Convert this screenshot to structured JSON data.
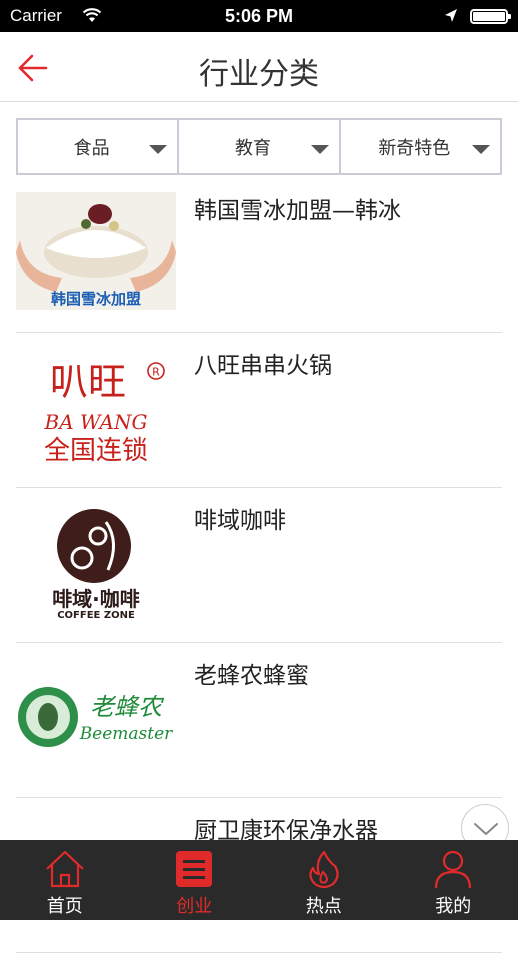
{
  "status_bar": {
    "carrier": "Carrier",
    "time": "5:06 PM"
  },
  "header": {
    "title": "行业分类",
    "back_icon": "back-arrow-icon"
  },
  "filters": [
    {
      "label": "食品"
    },
    {
      "label": "教育"
    },
    {
      "label": "新奇特色"
    }
  ],
  "items": [
    {
      "name": "韩国雪冰加盟—韩冰",
      "logo_text": "韩国雪冰加盟"
    },
    {
      "name": "八旺串串火锅",
      "logo_text_cn": "叭旺",
      "logo_text_en": "BA WANG",
      "logo_text_sub": "全国连锁"
    },
    {
      "name": "啡域咖啡",
      "logo_text_cn": "啡域·咖啡",
      "logo_text_en": "COFFEE ZONE"
    },
    {
      "name": "老蜂农蜂蜜",
      "logo_text_cn": "老蜂农",
      "logo_text_en": "Beemaster"
    },
    {
      "name": "厨卫康环保净水器"
    }
  ],
  "tabs": [
    {
      "label": "首页",
      "icon": "home-icon"
    },
    {
      "label": "创业",
      "icon": "list-icon",
      "active": true
    },
    {
      "label": "热点",
      "icon": "flame-icon"
    },
    {
      "label": "我的",
      "icon": "user-icon"
    }
  ],
  "colors": {
    "accent": "#e12b2b",
    "tabbar_bg": "#2a2a2a"
  }
}
